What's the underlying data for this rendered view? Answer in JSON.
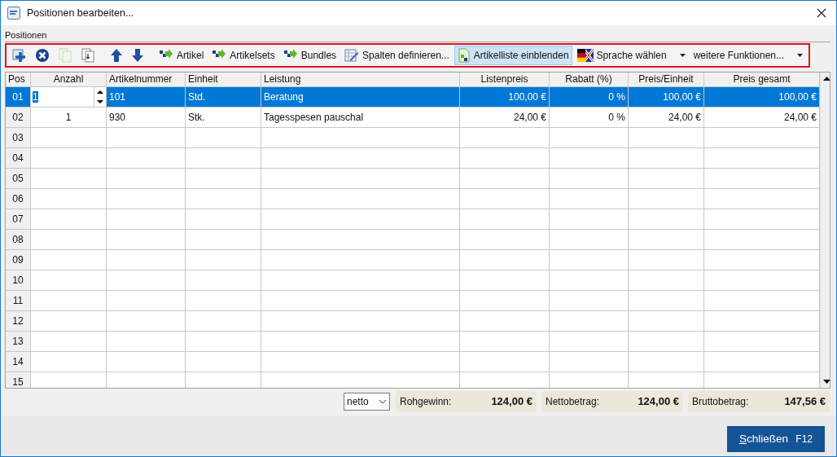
{
  "window": {
    "title": "Positionen bearbeiten..."
  },
  "group_label": "Positionen",
  "toolbar": [
    {
      "kind": "add",
      "selected": false,
      "disabled": false
    },
    {
      "kind": "delete",
      "selected": false,
      "disabled": false
    },
    {
      "kind": "copy",
      "selected": false,
      "disabled": true
    },
    {
      "kind": "paste",
      "selected": false,
      "disabled": false
    },
    {
      "kind": "up",
      "selected": false,
      "disabled": false
    },
    {
      "kind": "down",
      "selected": false,
      "disabled": false
    },
    {
      "kind": "insert",
      "label": "Artikel",
      "selected": false,
      "disabled": false
    },
    {
      "kind": "insert",
      "label": "Artikelsets",
      "selected": false,
      "disabled": false
    },
    {
      "kind": "insert",
      "label": "Bundles",
      "selected": false,
      "disabled": false
    },
    {
      "kind": "edit",
      "label": "Spalten definieren...",
      "selected": false,
      "disabled": false
    },
    {
      "kind": "list",
      "label": "Artikelliste einblenden",
      "selected": true,
      "disabled": false
    },
    {
      "kind": "flag",
      "label": "Sprache wählen",
      "dropdown": true,
      "selected": false,
      "disabled": false
    },
    {
      "kind": "text",
      "label": "weitere Funktionen...",
      "dropdown": true,
      "selected": false,
      "disabled": false
    }
  ],
  "table": {
    "columns": [
      "Pos",
      "Anzahl",
      "Artikelnummer",
      "Einheit",
      "Leistung",
      "Listenpreis",
      "Rabatt (%)",
      "Preis/Einheit",
      "Preis gesamt"
    ],
    "rows": [
      {
        "selected": true,
        "editing": true,
        "cells": [
          "01",
          "1",
          "101",
          "Std.",
          "Beratung",
          "100,00 €",
          "0 %",
          "100,00 €",
          "100,00 €"
        ]
      },
      {
        "selected": false,
        "editing": false,
        "cells": [
          "02",
          "1",
          "930",
          "Stk.",
          "Tagesspesen pauschal",
          "24,00 €",
          "0 %",
          "24,00 €",
          "24,00 €"
        ]
      },
      {
        "selected": false,
        "editing": false,
        "cells": [
          "03"
        ]
      },
      {
        "selected": false,
        "editing": false,
        "cells": [
          "04"
        ]
      },
      {
        "selected": false,
        "editing": false,
        "cells": [
          "05"
        ]
      },
      {
        "selected": false,
        "editing": false,
        "cells": [
          "06"
        ]
      },
      {
        "selected": false,
        "editing": false,
        "cells": [
          "07"
        ]
      },
      {
        "selected": false,
        "editing": false,
        "cells": [
          "08"
        ]
      },
      {
        "selected": false,
        "editing": false,
        "cells": [
          "09"
        ]
      },
      {
        "selected": false,
        "editing": false,
        "cells": [
          "10"
        ]
      },
      {
        "selected": false,
        "editing": false,
        "cells": [
          "11"
        ]
      },
      {
        "selected": false,
        "editing": false,
        "cells": [
          "12"
        ]
      },
      {
        "selected": false,
        "editing": false,
        "cells": [
          "13"
        ]
      },
      {
        "selected": false,
        "editing": false,
        "cells": [
          "14"
        ]
      },
      {
        "selected": false,
        "editing": false,
        "cells": [
          "15"
        ]
      }
    ]
  },
  "tax_mode": "netto",
  "totals": [
    {
      "label": "Rohgewinn:",
      "value": "124,00 €"
    },
    {
      "label": "Nettobetrag:",
      "value": "124,00 €"
    },
    {
      "label": "Bruttobetrag:",
      "value": "147,56 €"
    }
  ],
  "close_button": {
    "label": "Schließen",
    "shortcut": "F12"
  }
}
